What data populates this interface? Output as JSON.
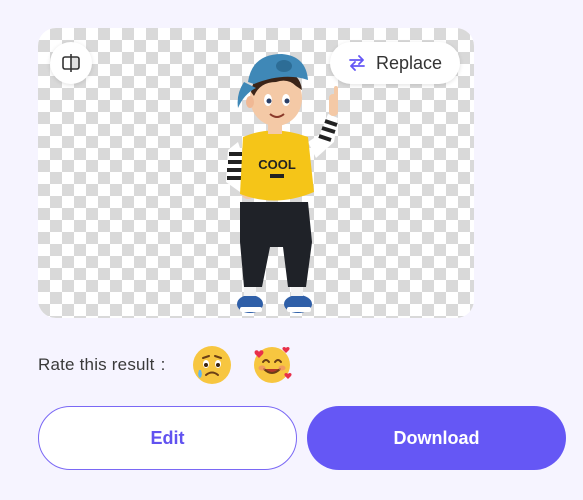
{
  "preview": {
    "replace_label": "Replace",
    "compare_icon": "compare-icon",
    "replace_icon": "swap-arrows-icon"
  },
  "rating": {
    "label": "Rate this result",
    "separator": ":",
    "options": [
      {
        "icon": "sad-face-emoji"
      },
      {
        "icon": "smiling-face-with-hearts-emoji"
      }
    ]
  },
  "actions": {
    "edit_label": "Edit",
    "download_label": "Download"
  },
  "colors": {
    "accent": "#6557f5",
    "page_bg": "#f6f4ff",
    "checker": "#d9d9d9"
  }
}
